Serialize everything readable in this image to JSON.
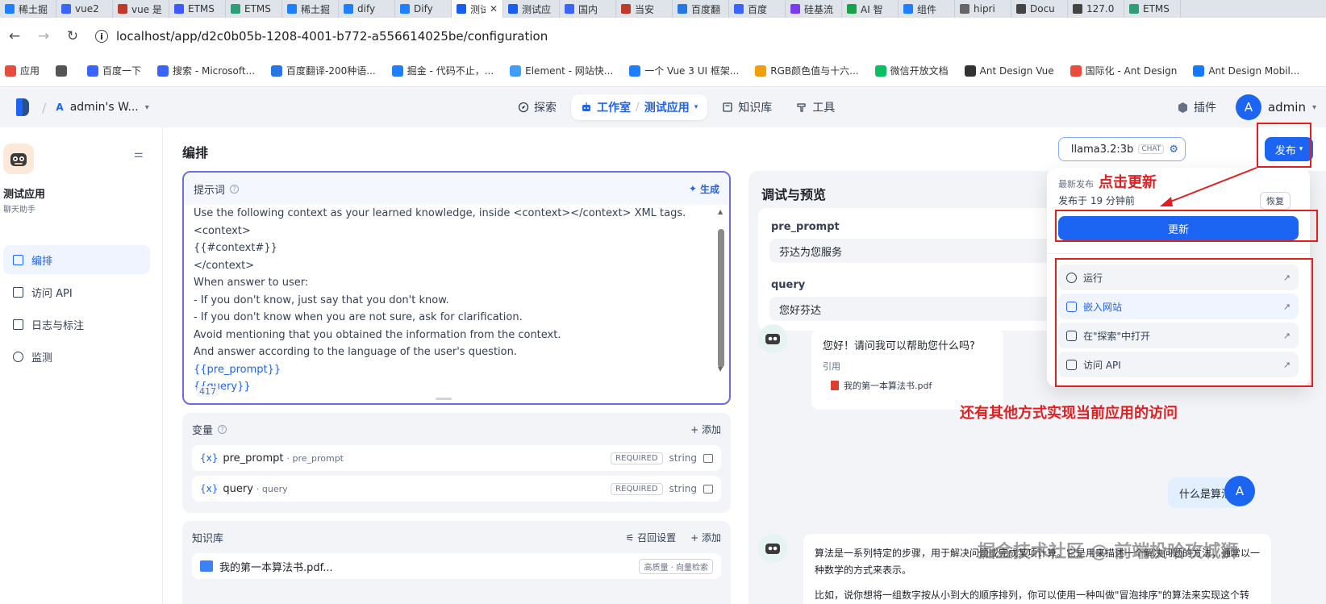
{
  "browser": {
    "tabs": [
      {
        "label": "稀土掘",
        "color": "#1e80ff"
      },
      {
        "label": "vue2",
        "color": "#3964fe"
      },
      {
        "label": "vue 是",
        "color": "#c0392b"
      },
      {
        "label": "ETMS",
        "color": "#3d5afe"
      },
      {
        "label": "ETMS",
        "color": "#2f9e78"
      },
      {
        "label": "稀土掘",
        "color": "#1e80ff"
      },
      {
        "label": "dify",
        "color": "#1e80ff"
      },
      {
        "label": "Dify",
        "color": "#1e80ff"
      },
      {
        "label": "测试应",
        "color": "#155eef",
        "close": "✕"
      },
      {
        "label": "测试应",
        "color": "#155eef"
      },
      {
        "label": "国内",
        "color": "#3964fe"
      },
      {
        "label": "当安",
        "color": "#c0392b"
      },
      {
        "label": "百度翻",
        "color": "#2577e3"
      },
      {
        "label": "百度",
        "color": "#3964fe"
      },
      {
        "label": "硅基流",
        "color": "#7c3aed"
      },
      {
        "label": "AI 智",
        "color": "#16a34a"
      },
      {
        "label": "组件",
        "color": "#1e80ff"
      },
      {
        "label": "hipri",
        "color": "#666666"
      },
      {
        "label": "Docu",
        "color": "#444444"
      },
      {
        "label": "127.0",
        "color": "#444444"
      },
      {
        "label": "ETMS",
        "color": "#2f9e78"
      }
    ],
    "url": "localhost/app/d2c0b05b-1208-4001-b772-a556614025be/configuration",
    "bookmarks": [
      {
        "label": "应用",
        "color": "#e74c3c"
      },
      {
        "label": "",
        "color": "#555555"
      },
      {
        "label": "百度一下",
        "color": "#3964fe"
      },
      {
        "label": "搜索 - Microsoft...",
        "color": "#3964fe"
      },
      {
        "label": "百度翻译-200种语...",
        "color": "#2577e3"
      },
      {
        "label": "掘金 - 代码不止，...",
        "color": "#1e80ff"
      },
      {
        "label": "Element - 网站快...",
        "color": "#409eff"
      },
      {
        "label": "一个 Vue 3 UI 框架...",
        "color": "#1e80ff"
      },
      {
        "label": "RGB颜色值与十六...",
        "color": "#f59e0b"
      },
      {
        "label": "微信开放文档",
        "color": "#07c160"
      },
      {
        "label": "Ant Design Vue",
        "color": "#333333"
      },
      {
        "label": "国际化 - Ant Design",
        "color": "#e74c3c"
      },
      {
        "label": "Ant Design Mobil...",
        "color": "#1677ff"
      }
    ]
  },
  "header": {
    "workspace_initial": "A",
    "workspace": "admin's W...",
    "nav": {
      "explore": "探索",
      "studio": "工作室",
      "app": "测试应用",
      "knowledge": "知识库",
      "tools": "工具"
    },
    "plugins": "插件",
    "user_initial": "A",
    "user": "admin"
  },
  "sidebar": {
    "app_name": "测试应用",
    "app_type": "聊天助手",
    "items": [
      {
        "label": "编排",
        "active": true,
        "icon": "layout-icon"
      },
      {
        "label": "访问 API",
        "active": false,
        "icon": "terminal-icon"
      },
      {
        "label": "日志与标注",
        "active": false,
        "icon": "file-list-icon"
      },
      {
        "label": "监测",
        "active": false,
        "icon": "gauge-icon"
      }
    ]
  },
  "main": {
    "title": "编排",
    "prompt": {
      "label": "提示词",
      "generate": "生成",
      "lines": [
        {
          "text": "Use the following context as your learned knowledge, inside <context></context> XML tags.",
          "var": false
        },
        {
          "text": "<context>",
          "var": false
        },
        {
          "text": "{{#context#}}",
          "var": false
        },
        {
          "text": "</context>",
          "var": false
        },
        {
          "text": "When answer to user:",
          "var": false
        },
        {
          "text": "- If you don't know, just say that you don't know.",
          "var": false
        },
        {
          "text": "- If you don't know when you are not sure, ask for clarification.",
          "var": false
        },
        {
          "text": "Avoid mentioning that you obtained the information from the context.",
          "var": false
        },
        {
          "text": "And answer according to the language of the user's question.",
          "var": false
        },
        {
          "text": "{{pre_prompt}}",
          "var": true
        },
        {
          "text": "{{query}}",
          "var": true
        }
      ],
      "char_count": "417"
    },
    "variables": {
      "label": "变量",
      "add": "+ 添加",
      "rows": [
        {
          "name": "pre_prompt",
          "label": "· pre_prompt",
          "required": "REQUIRED",
          "type": "string"
        },
        {
          "name": "query",
          "label": "· query",
          "required": "REQUIRED",
          "type": "string"
        }
      ]
    },
    "knowledge": {
      "label": "知识库",
      "recall": "召回设置",
      "add": "+ 添加",
      "file": "我的第一本算法书.pdf...",
      "tag": "高质量 · 向量检索"
    }
  },
  "debug": {
    "title": "调试与预览",
    "inputs": [
      {
        "label": "pre_prompt",
        "value": "芬达为您服务"
      },
      {
        "label": "query",
        "value": "您好芬达"
      }
    ],
    "bot_greeting": "您好！请问我可以帮助您什么吗?",
    "citation_label": "引用",
    "citation_file": "我的第一本算法书.pdf",
    "user_initial": "A",
    "user_message": "什么是算法",
    "answer_p1": "算法是一系列特定的步骤，用于解决问题或完成某项计算。它是用来描述一个解决问题的方法，通常以一种数学的方式来表示。",
    "answer_p2": "比如，说你想将一组数字按从小到大的顺序排列，你可以使用一种叫做\"冒泡排序\"的算法来实现这个转换。"
  },
  "toolbar": {
    "model": "llama3.2:3b",
    "model_badge": "CHAT",
    "publish": "发布"
  },
  "publish_popover": {
    "recent_label": "最新发布",
    "published_time": "发布于 19 分钟前",
    "restore": "恢复",
    "update": "更新",
    "items": [
      {
        "label": "运行",
        "icon": "play-circle-icon",
        "highlight": false
      },
      {
        "label": "嵌入网站",
        "icon": "embed-icon",
        "highlight": true
      },
      {
        "label": "在\"探索\"中打开",
        "icon": "compass-icon",
        "highlight": false
      },
      {
        "label": "访问 API",
        "icon": "document-icon",
        "highlight": false
      }
    ],
    "arrow": "↗"
  },
  "annotations": {
    "click_update": "点击更新",
    "other_ways": "还有其他方式实现当前应用的访问",
    "color": "#e02020"
  },
  "watermark": "掘金技术社区 @ 前端投哈攻城狮"
}
